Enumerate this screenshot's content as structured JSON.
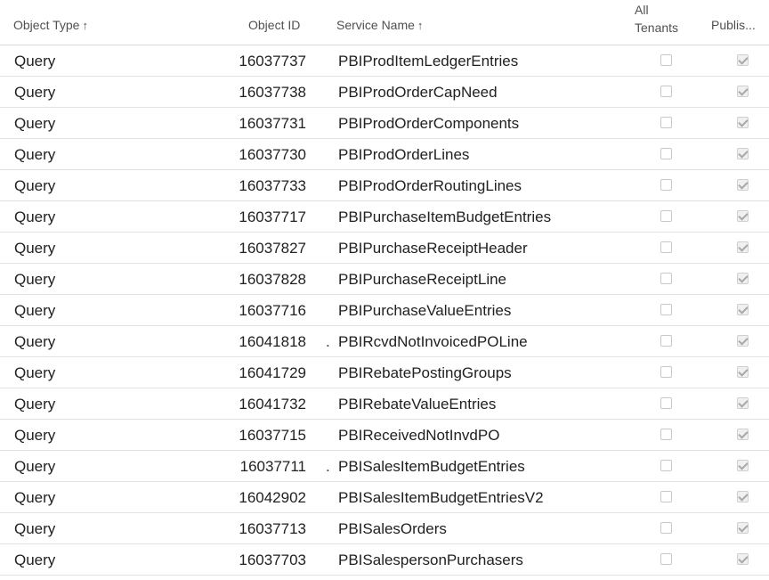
{
  "columns": {
    "object_type": "Object Type",
    "object_id": "Object ID",
    "service_name": "Service Name",
    "all_tenants_line1": "All",
    "all_tenants_line2": "Tenants",
    "published": "Publis..."
  },
  "sort_indicators": {
    "object_type": "↑",
    "service_name": "↑"
  },
  "rows": [
    {
      "object_type": "Query",
      "object_id": "16037737",
      "marker": "",
      "service_name": "PBIProdItemLedgerEntries",
      "all_tenants": false,
      "published": true
    },
    {
      "object_type": "Query",
      "object_id": "16037738",
      "marker": "",
      "service_name": "PBIProdOrderCapNeed",
      "all_tenants": false,
      "published": true
    },
    {
      "object_type": "Query",
      "object_id": "16037731",
      "marker": "",
      "service_name": "PBIProdOrderComponents",
      "all_tenants": false,
      "published": true
    },
    {
      "object_type": "Query",
      "object_id": "16037730",
      "marker": "",
      "service_name": "PBIProdOrderLines",
      "all_tenants": false,
      "published": true
    },
    {
      "object_type": "Query",
      "object_id": "16037733",
      "marker": "",
      "service_name": "PBIProdOrderRoutingLines",
      "all_tenants": false,
      "published": true
    },
    {
      "object_type": "Query",
      "object_id": "16037717",
      "marker": "",
      "service_name": "PBIPurchaseItemBudgetEntries",
      "all_tenants": false,
      "published": true
    },
    {
      "object_type": "Query",
      "object_id": "16037827",
      "marker": "",
      "service_name": "PBIPurchaseReceiptHeader",
      "all_tenants": false,
      "published": true
    },
    {
      "object_type": "Query",
      "object_id": "16037828",
      "marker": "",
      "service_name": "PBIPurchaseReceiptLine",
      "all_tenants": false,
      "published": true
    },
    {
      "object_type": "Query",
      "object_id": "16037716",
      "marker": "",
      "service_name": "PBIPurchaseValueEntries",
      "all_tenants": false,
      "published": true
    },
    {
      "object_type": "Query",
      "object_id": "16041818",
      "marker": ".",
      "service_name": "PBIRcvdNotInvoicedPOLine",
      "all_tenants": false,
      "published": true
    },
    {
      "object_type": "Query",
      "object_id": "16041729",
      "marker": "",
      "service_name": "PBIRebatePostingGroups",
      "all_tenants": false,
      "published": true
    },
    {
      "object_type": "Query",
      "object_id": "16041732",
      "marker": "",
      "service_name": "PBIRebateValueEntries",
      "all_tenants": false,
      "published": true
    },
    {
      "object_type": "Query",
      "object_id": "16037715",
      "marker": "",
      "service_name": "PBIReceivedNotInvdPO",
      "all_tenants": false,
      "published": true
    },
    {
      "object_type": "Query",
      "object_id": "16037711",
      "marker": ".",
      "service_name": "PBISalesItemBudgetEntries",
      "all_tenants": false,
      "published": true
    },
    {
      "object_type": "Query",
      "object_id": "16042902",
      "marker": "",
      "service_name": "PBISalesItemBudgetEntriesV2",
      "all_tenants": false,
      "published": true
    },
    {
      "object_type": "Query",
      "object_id": "16037713",
      "marker": "",
      "service_name": "PBISalesOrders",
      "all_tenants": false,
      "published": true
    },
    {
      "object_type": "Query",
      "object_id": "16037703",
      "marker": "",
      "service_name": "PBISalespersonPurchasers",
      "all_tenants": false,
      "published": true
    }
  ]
}
